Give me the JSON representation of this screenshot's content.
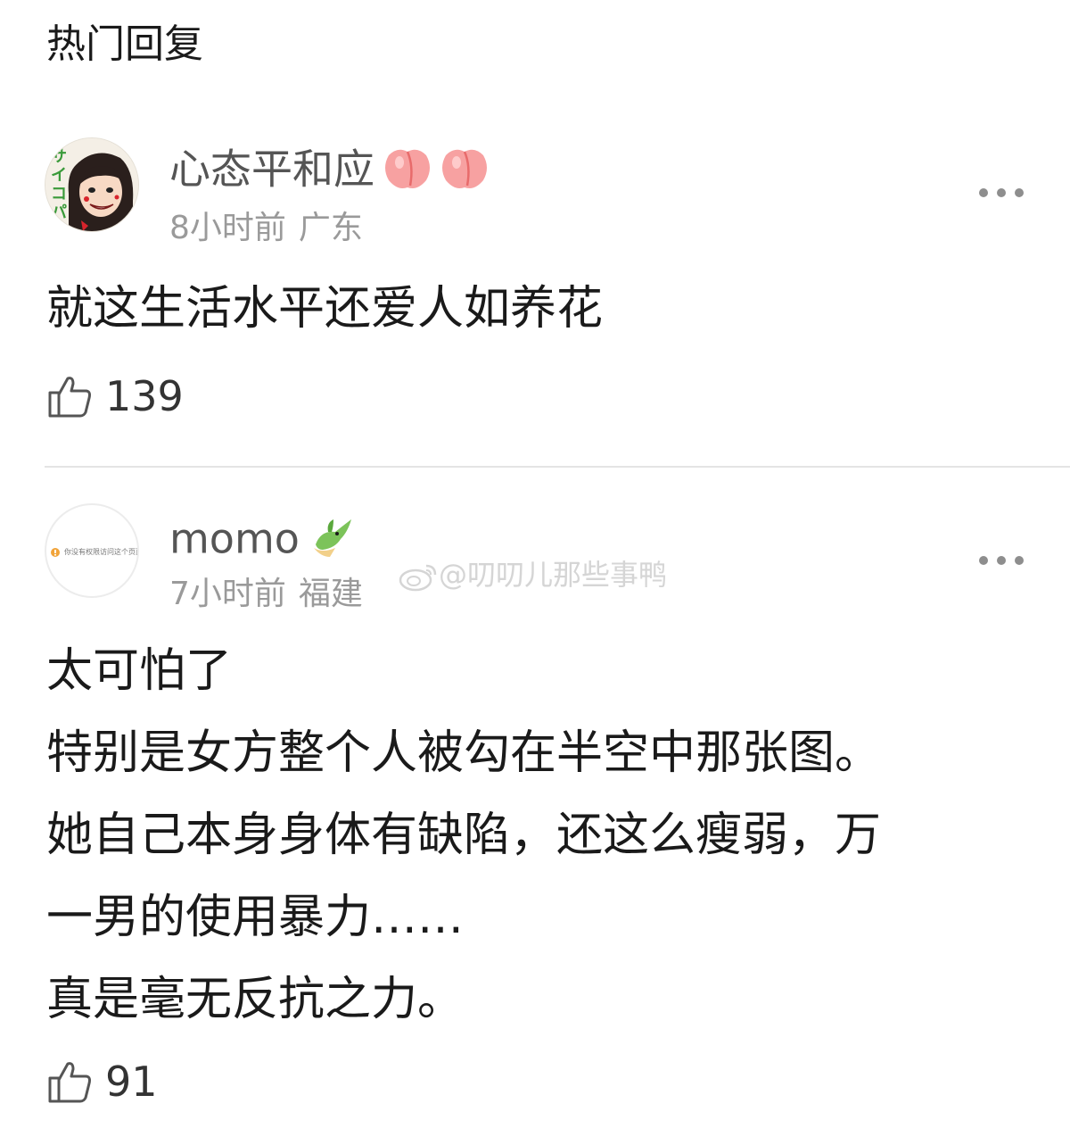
{
  "section": {
    "title": "热门回复"
  },
  "comments": [
    {
      "username": "心态平和应",
      "badges": [
        "peach-icon",
        "peach-icon"
      ],
      "time": "8小时前",
      "location": "广东",
      "lines": [
        "就这生活水平还爱人如养花"
      ],
      "likes": "139",
      "avatar": {
        "text": "サイコパ"
      }
    },
    {
      "username": "momo",
      "badges": [
        "bird-icon"
      ],
      "time": "7小时前",
      "location": "福建",
      "lines": [
        "太可怕了",
        "特别是女方整个人被勾在半空中那张图。",
        "她自己本身身体有缺陷，还这么瘦弱，万",
        "一男的使用暴力……",
        "真是毫无反抗之力。"
      ],
      "likes": "91",
      "avatar": {
        "text": "你没有权限访问这个页面"
      }
    }
  ],
  "watermark": {
    "text": "@叨叨儿那些事鸭"
  },
  "colors": {
    "text_primary": "#1a1a1a",
    "username": "#555555",
    "meta": "#9a9a9a",
    "divider": "#e4e4e4",
    "peach": "#f27a7a",
    "bird_green": "#7cc35a"
  }
}
